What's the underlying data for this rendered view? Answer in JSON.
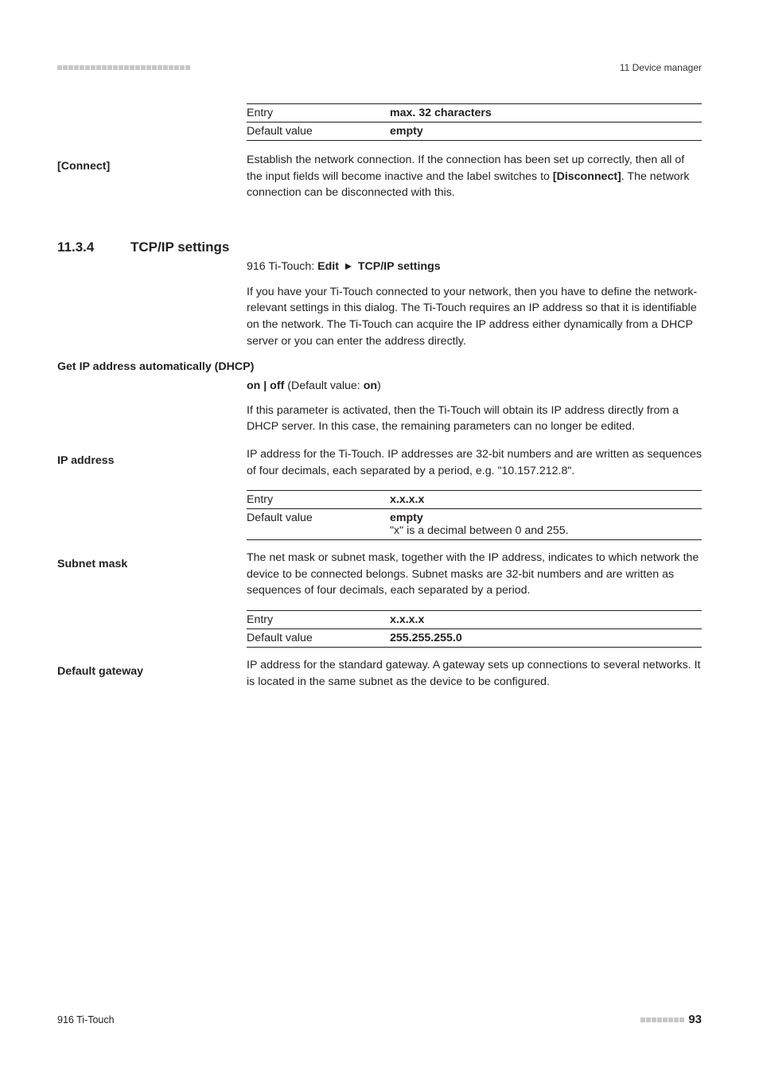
{
  "header": {
    "chapter": "11 Device manager"
  },
  "tables": {
    "t1": {
      "r1k": "Entry",
      "r1v": "max. 32 characters",
      "r2k": "Default value",
      "r2v": "empty"
    },
    "t2": {
      "r1k": "Entry",
      "r1v": "x.x.x.x",
      "r2k": "Default value",
      "r2v": "empty",
      "note": "\"x\" is a decimal between 0 and 255."
    },
    "t3": {
      "r1k": "Entry",
      "r1v": "x.x.x.x",
      "r2k": "Default value",
      "r2v": "255.255.255.0"
    }
  },
  "labels": {
    "connect": "[Connect]",
    "getip": "Get IP address automatically (DHCP)",
    "ipaddress": "IP address",
    "subnet": "Subnet mask",
    "gateway": "Default gateway"
  },
  "section": {
    "num": "11.3.4",
    "title": "TCP/IP settings",
    "breadcrumb_pre": "916 Ti-Touch: ",
    "breadcrumb_b1": "Edit",
    "breadcrumb_b2": "TCP/IP settings"
  },
  "paras": {
    "connect": "Establish the network connection. If the connection has been set up correctly, then all of the input fields will become inactive and the label switches to ",
    "connect_b": "[Disconnect]",
    "connect_post": ". The network connection can be disconnected with this.",
    "tcp_intro": "If you have your Ti-Touch connected to your network, then you have to define the network-relevant settings in this dialog. The Ti-Touch requires an IP address so that it is identifiable on the network. The Ti-Touch can acquire the IP address either dynamically from a DHCP server or you can enter the address directly.",
    "onoff_pre": "on | off",
    "onoff_mid": " (Default value: ",
    "onoff_val": "on",
    "onoff_post": ")",
    "dhcp_desc": "If this parameter is activated, then the Ti-Touch will obtain its IP address directly from a DHCP server. In this case, the remaining parameters can no longer be edited.",
    "ipaddr": "IP address for the Ti-Touch. IP addresses are 32-bit numbers and are written as sequences of four decimals, each separated by a period, e.g. \"10.157.212.8\".",
    "subnet": "The net mask or subnet mask, together with the IP address, indicates to which network the device to be connected belongs. Subnet masks are 32-bit numbers and are written as sequences of four decimals, each separated by a period.",
    "gateway": "IP address for the standard gateway. A gateway sets up connections to several networks. It is located in the same subnet as the device to be configured."
  },
  "footer": {
    "product": "916 Ti-Touch",
    "page": "93"
  }
}
